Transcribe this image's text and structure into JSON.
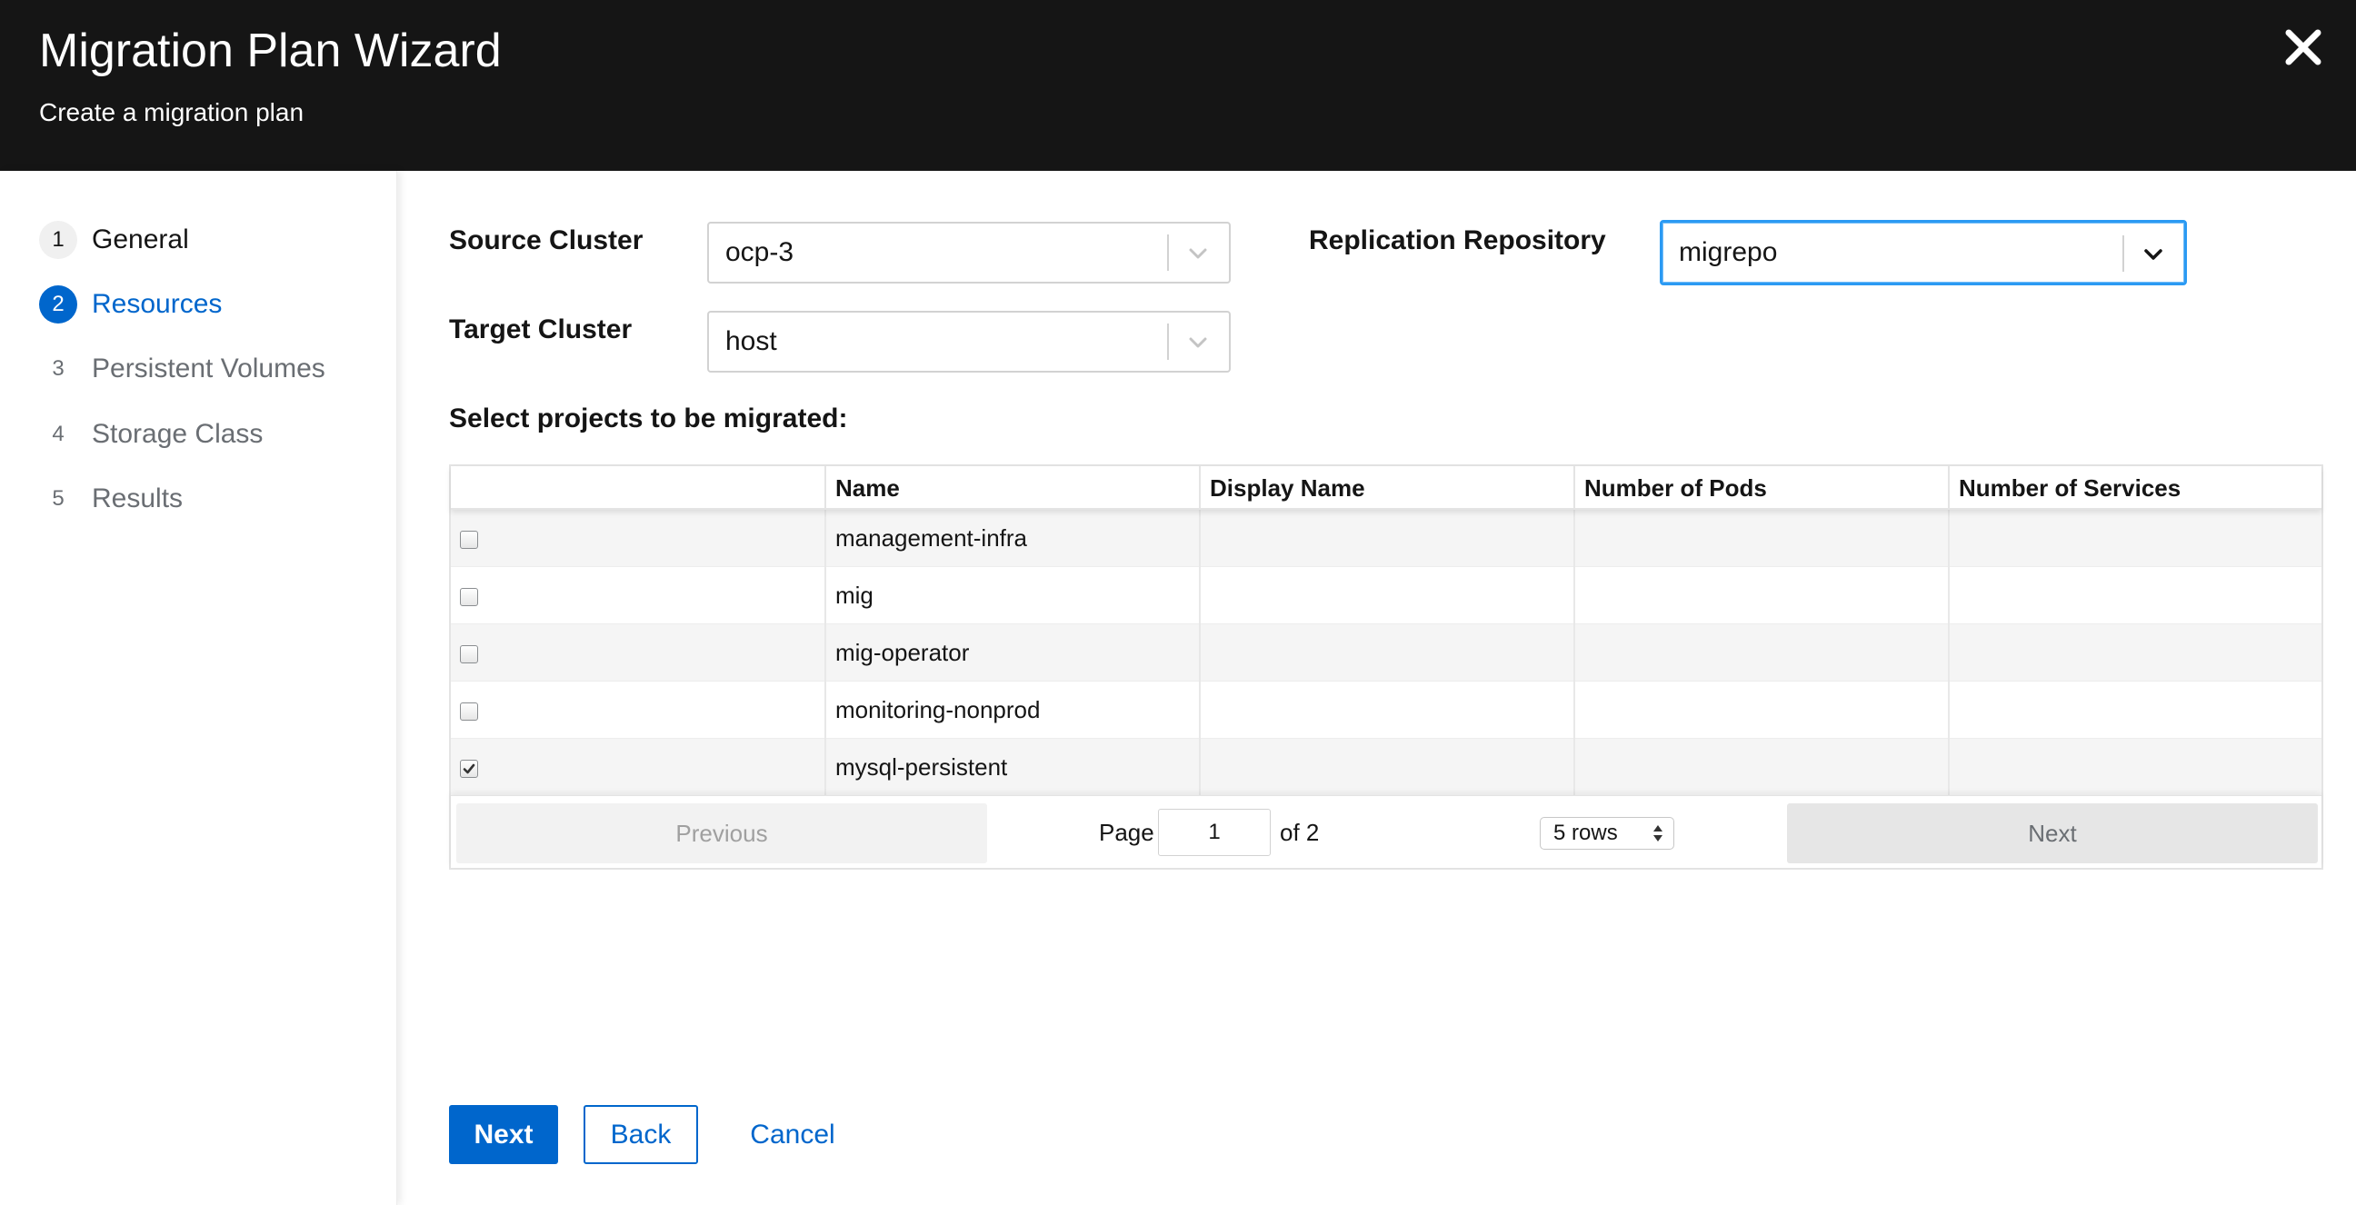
{
  "header": {
    "title": "Migration Plan Wizard",
    "subtitle": "Create a migration plan",
    "close_icon": "close-icon"
  },
  "nav": {
    "steps": [
      {
        "number": "1",
        "label": "General",
        "state": "done"
      },
      {
        "number": "2",
        "label": "Resources",
        "state": "current"
      },
      {
        "number": "3",
        "label": "Persistent Volumes",
        "state": "upcoming"
      },
      {
        "number": "4",
        "label": "Storage Class",
        "state": "upcoming"
      },
      {
        "number": "5",
        "label": "Results",
        "state": "upcoming"
      }
    ]
  },
  "form": {
    "source_cluster": {
      "label": "Source Cluster",
      "value": "ocp-3"
    },
    "target_cluster": {
      "label": "Target Cluster",
      "value": "host"
    },
    "replication_repository": {
      "label": "Replication Repository",
      "value": "migrepo"
    }
  },
  "projects": {
    "title": "Select projects to be migrated:",
    "columns": [
      "",
      "Name",
      "Display Name",
      "Number of Pods",
      "Number of Services"
    ],
    "rows": [
      {
        "checked": false,
        "name": "management-infra",
        "display_name": "",
        "pods": "",
        "services": ""
      },
      {
        "checked": false,
        "name": "mig",
        "display_name": "",
        "pods": "",
        "services": ""
      },
      {
        "checked": false,
        "name": "mig-operator",
        "display_name": "",
        "pods": "",
        "services": ""
      },
      {
        "checked": false,
        "name": "monitoring-nonprod",
        "display_name": "",
        "pods": "",
        "services": ""
      },
      {
        "checked": true,
        "name": "mysql-persistent",
        "display_name": "",
        "pods": "",
        "services": ""
      }
    ],
    "pagination": {
      "previous_label": "Previous",
      "next_label": "Next",
      "page_label": "Page",
      "page_value": "1",
      "of_label": "of 2",
      "rows_label": "5 rows"
    }
  },
  "footer": {
    "next_label": "Next",
    "back_label": "Back",
    "cancel_label": "Cancel"
  },
  "colors": {
    "header_bg": "#151515",
    "accent": "#0066cc",
    "focus_border": "#2b9af3",
    "row_stripe": "#f5f5f5"
  }
}
